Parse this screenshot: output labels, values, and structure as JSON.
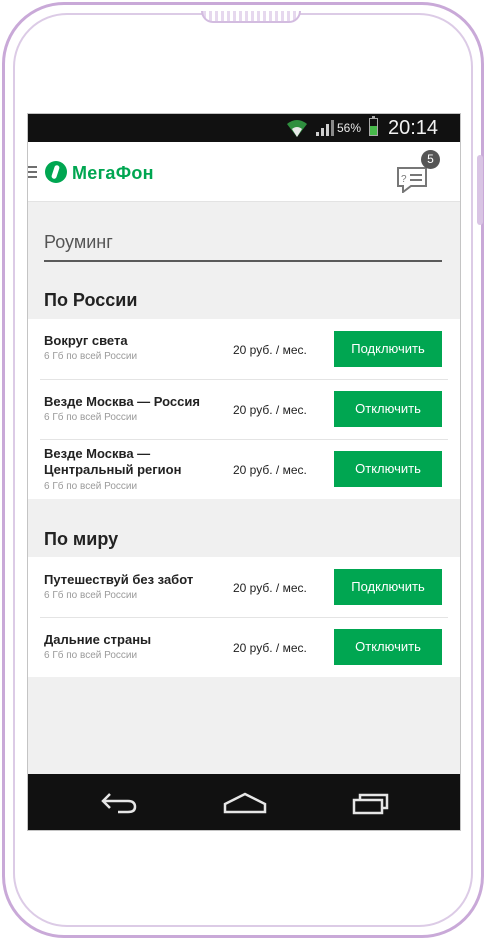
{
  "status_bar": {
    "battery_percent": "56%",
    "time": "20:14"
  },
  "app_bar": {
    "logo_text": "МегаФон",
    "chat_badge_count": "5"
  },
  "page": {
    "title": "Роуминг"
  },
  "groups": [
    {
      "header": "По России",
      "items": [
        {
          "name": "Вокруг света",
          "desc": "6 Гб по всей России",
          "price": "20 руб. / мес.",
          "button": "Подключить"
        },
        {
          "name": "Везде Москва — Россия",
          "desc": "6 Гб по всей России",
          "price": "20 руб. / мес.",
          "button": "Отключить"
        },
        {
          "name": "Везде Москва — Центральный регион",
          "desc": "6 Гб по всей России",
          "price": "20 руб. / мес.",
          "button": "Отключить"
        }
      ]
    },
    {
      "header": "По миру",
      "items": [
        {
          "name": "Путешествуй без забот",
          "desc": "6 Гб по всей России",
          "price": "20 руб. / мес.",
          "button": "Подключить"
        },
        {
          "name": "Дальние страны",
          "desc": "6 Гб по всей России",
          "price": "20 руб. / мес.",
          "button": "Отключить"
        }
      ]
    }
  ],
  "colors": {
    "brand_green": "#00a651",
    "phone_frame": "#c9a9d8"
  }
}
